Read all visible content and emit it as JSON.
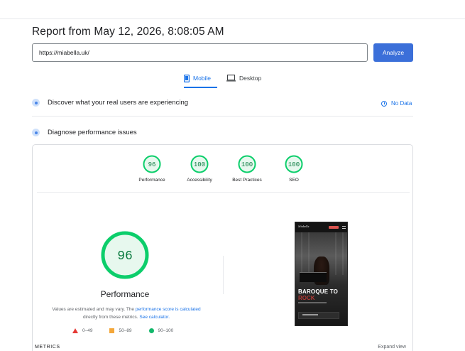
{
  "report": {
    "title": "Report from May 12, 2026, 8:08:05 AM"
  },
  "url_input": {
    "value": "https://miabella.uk/"
  },
  "analyze_button": {
    "label": "Analyze"
  },
  "tabs": [
    {
      "label": "Mobile",
      "icon": "smartphone-icon",
      "selected": true
    },
    {
      "label": "Desktop",
      "icon": "laptop-icon",
      "selected": false
    }
  ],
  "field_data": {
    "title": "Discover what your real users are experiencing",
    "status": "No Data",
    "icon": "users-icon"
  },
  "diagnose": {
    "title": "Diagnose performance issues",
    "icon": "lab-icon"
  },
  "categories": [
    {
      "label": "Performance",
      "score": "96"
    },
    {
      "label": "Accessibility",
      "score": "100"
    },
    {
      "label": "Best Practices",
      "score": "100"
    },
    {
      "label": "SEO",
      "score": "100"
    }
  ],
  "main_score": {
    "score": "96",
    "label": "Performance",
    "note_part1": "Values are estimated and may vary. The ",
    "note_link1": "performance score is calculated",
    "note_part2": " directly from these metrics. ",
    "note_link2": "See calculator."
  },
  "legend": [
    {
      "range": "0–49",
      "color": "#e53935",
      "shape": "triangle"
    },
    {
      "range": "50–89",
      "color": "#f4a73a",
      "shape": "square"
    },
    {
      "range": "90–100",
      "color": "#12b76a",
      "shape": "circle"
    }
  ],
  "screenshot": {
    "logo": "Miabella",
    "headline_line1": "BAROQUE TO",
    "headline_line2": "ROCK"
  },
  "metrics": {
    "label": "METRICS",
    "expand": "Expand view"
  },
  "colors": {
    "good": "#0cce6b",
    "good_fill": "#e7f8ee",
    "good_text": "#0a7a3f",
    "accent": "#1a73e8",
    "button": "#3b6fd9"
  }
}
